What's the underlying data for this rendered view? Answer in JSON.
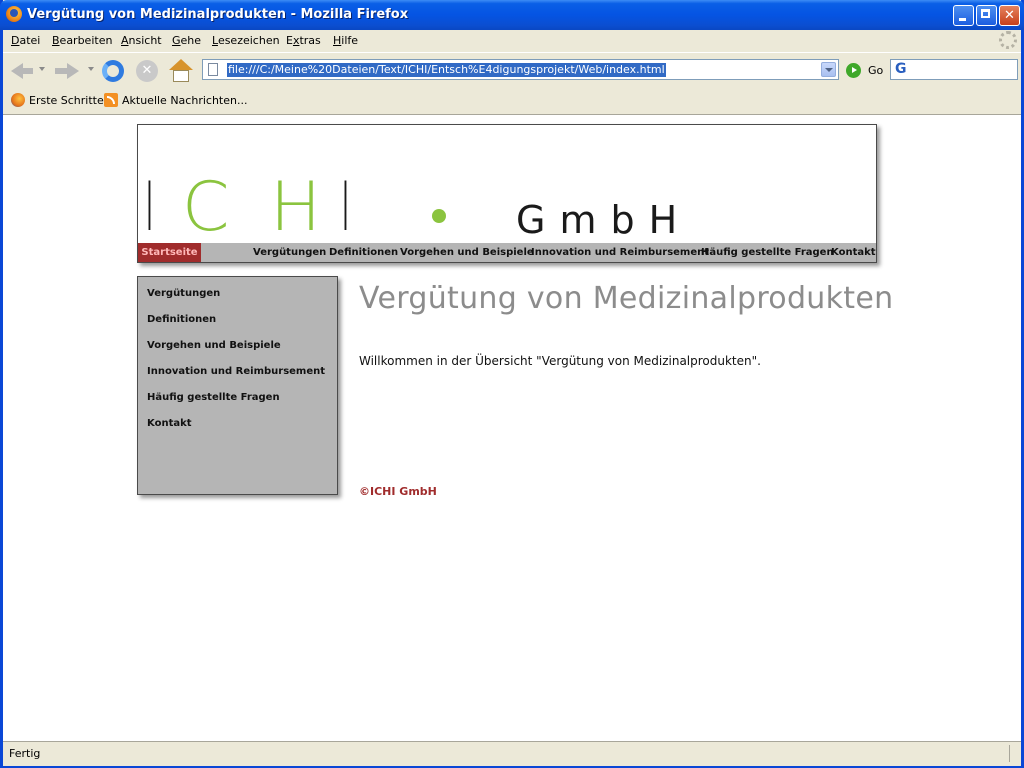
{
  "window": {
    "title": "Vergütung von Medizinalprodukten - Mozilla Firefox"
  },
  "menu": [
    {
      "u": "D",
      "rest": "atei"
    },
    {
      "u": "B",
      "rest": "earbeiten"
    },
    {
      "u": "A",
      "rest": "nsicht"
    },
    {
      "u": "G",
      "rest": "ehe"
    },
    {
      "u": "L",
      "rest": "esezeichen"
    },
    {
      "pre": "E",
      "u": "x",
      "rest": "tras"
    },
    {
      "u": "H",
      "rest": "ilfe"
    }
  ],
  "toolbar": {
    "url": "file:///C:/Meine%20Dateien/Text/ICHI/Entsch%E4digungsprojekt/Web/index.html",
    "go_label": "Go",
    "search_engine_glyph": "G"
  },
  "bookmarks": [
    {
      "label": "Erste Schritte",
      "icon": "firefox-icon"
    },
    {
      "label": "Aktuelle Nachrichten...",
      "icon": "rss-feed-icon"
    }
  ],
  "page": {
    "logo": {
      "letters": [
        "I",
        "C",
        "H",
        "I"
      ],
      "suffix": "GmbH",
      "colors": {
        "dark": "#1a1a1a",
        "green": "#8bc43f"
      }
    },
    "topnav": {
      "active": "Startseite",
      "items": [
        "Vergütungen",
        "Definitionen",
        "Vorgehen und Beispiele",
        "Innovation und Reimbursement",
        "Häufig gestellte Fragen",
        "Kontakt"
      ]
    },
    "sidebar": [
      "Vergütungen",
      "Definitionen",
      "Vorgehen und Beispiele",
      "Innovation und Reimbursement",
      "Häufig gestellte Fragen",
      "Kontakt"
    ],
    "heading": "Vergütung von Medizinalprodukten",
    "welcome": "Willkommen in der Übersicht \"Vergütung von Medizinalprodukten\".",
    "copyright": "©ICHI GmbH",
    "colors": {
      "accent": "#a02c2c",
      "nav_bg": "#b5b5b5",
      "heading": "#8c8c8c"
    }
  },
  "status": {
    "text": "Fertig"
  }
}
